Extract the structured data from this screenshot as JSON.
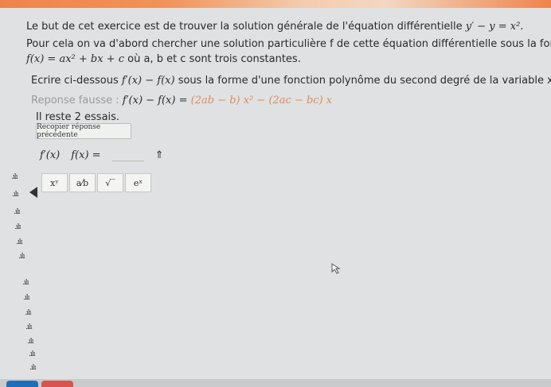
{
  "exercise": {
    "line1": "Le but de cet exercice est de trouver la solution générale de l'équation différentielle",
    "line1_eq": "y′ − y = x².",
    "line2": "Pour cela on va d'abord chercher une solution particulière f de cette équation différentielle sous la forme",
    "line3_eq": "f(x) = ax² + bx + c",
    "line3_tail": "où a, b et c sont trois constantes.",
    "instruction_head": "Ecrire ci-dessous",
    "instruction_eq": "f′(x) − f(x)",
    "instruction_tail": "sous la forme d'une fonction polynôme du second degré de la variable x :"
  },
  "feedback": {
    "label": "Reponse fausse :",
    "eq_left": "f′(x) − f(x) =",
    "eq_right": "(2ab − b) x² − (2ac − bc) x",
    "attempts": "Il reste 2 essais."
  },
  "copy_button": "Recopier réponse précédente",
  "input": {
    "prefix1": "f′(x)",
    "prefix2": "f(x) =",
    "up_arrow": "⇑"
  },
  "keyboard": [
    {
      "label": "xʸ",
      "icon": "power-icon"
    },
    {
      "label": "a⁄b",
      "icon": "fraction-icon"
    },
    {
      "label": "√‾",
      "icon": "sqrt-icon"
    },
    {
      "label": "eˣ",
      "icon": "exp-icon"
    }
  ],
  "signal_glyph": ".ılı"
}
